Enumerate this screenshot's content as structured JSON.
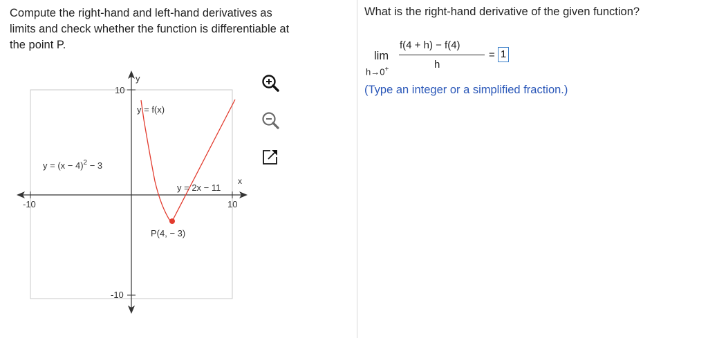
{
  "problem": {
    "line1": "Compute the right-hand and left-hand derivatives as",
    "line2": "limits and check whether the function is differentiable at",
    "line3": "the point P."
  },
  "graph": {
    "y_axis_label": "y",
    "x_axis_label": "x",
    "tick_pos_y": "10",
    "tick_neg_y": "-10",
    "tick_neg_x": "-10",
    "tick_pos_x": "10",
    "function_label": "y = f(x)",
    "left_piece_label": "y = (x − 4)",
    "left_piece_exp": "2",
    "left_piece_tail": " − 3",
    "right_piece_label": "y = 2x − 11",
    "point_label": "P(4, − 3)",
    "curve_color": "#e23b2e",
    "point_color": "#e23b2e"
  },
  "toolbar": {
    "zoom_in": "zoom-in-icon",
    "zoom_out": "zoom-out-icon",
    "popout": "popout-icon"
  },
  "question": {
    "prompt": "What is the right-hand derivative of the given function?",
    "lim": "lim",
    "lim_sub": "h→0",
    "lim_sub_sup": "+",
    "numerator": "f(4 + h) − f(4)",
    "denominator": "h",
    "equals": "=",
    "answer_value": "1",
    "hint": "(Type an integer or a simplified fraction.)"
  }
}
